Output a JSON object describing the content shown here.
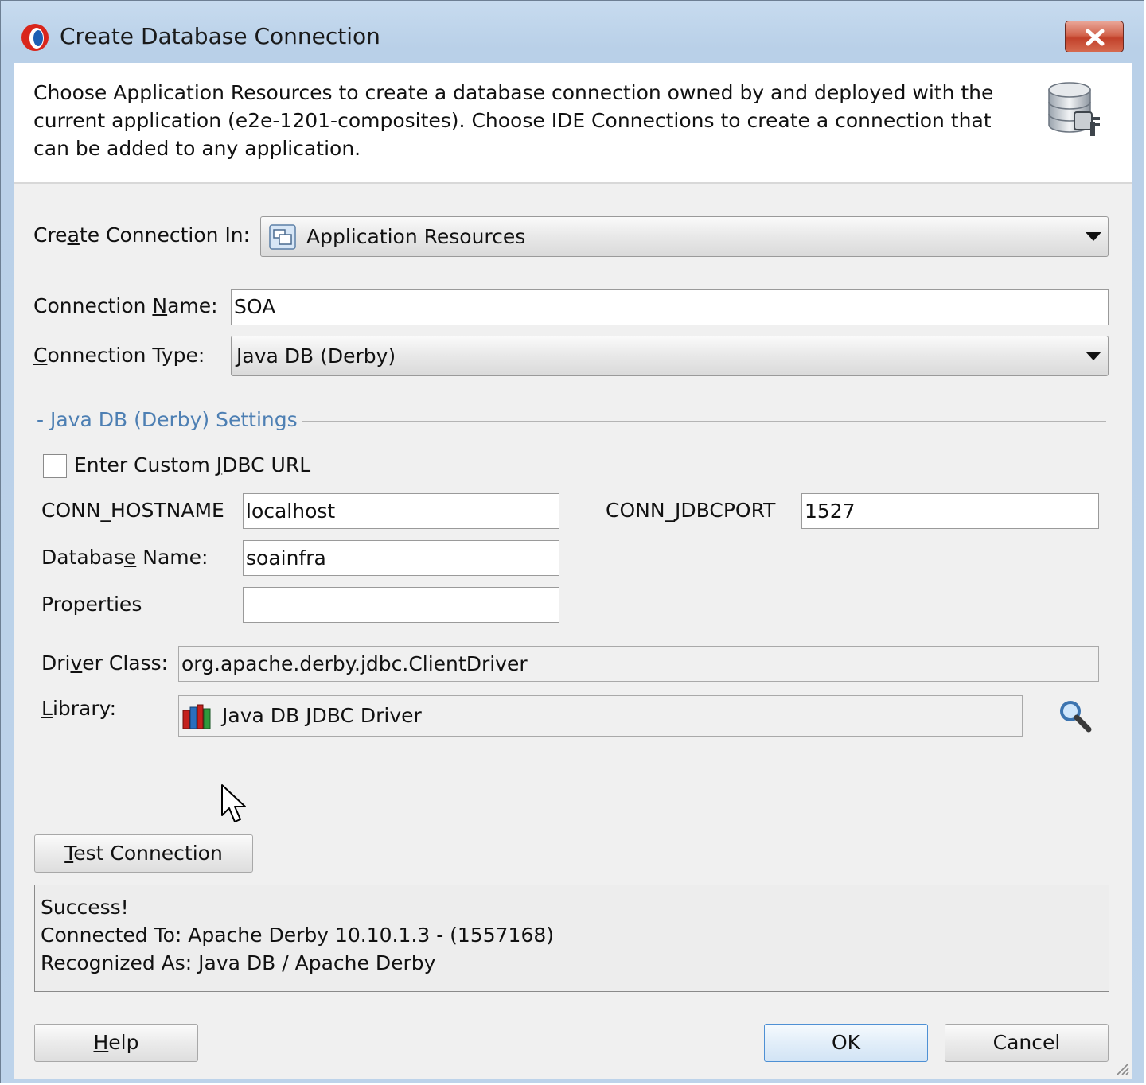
{
  "window": {
    "title": "Create Database Connection",
    "icon": "oracle-icon",
    "close_icon": "close-icon"
  },
  "banner": {
    "text": "Choose Application Resources to create a database connection owned by and deployed with the current application (e2e-1201-composites). Choose IDE Connections to create a connection that can be added to any application.",
    "icon": "database-connection-icon"
  },
  "form": {
    "create_in": {
      "label_pre": "Cre",
      "label_mnemonic": "a",
      "label_post": "te Connection In:",
      "value": "Application Resources",
      "icon": "application-resources-icon"
    },
    "conn_name": {
      "label_pre": "Connection ",
      "label_mnemonic": "N",
      "label_post": "ame:",
      "value": "SOA"
    },
    "conn_type": {
      "label_pre": "",
      "label_mnemonic": "C",
      "label_post": "onnection Type:",
      "value": "Java DB (Derby)"
    }
  },
  "settings": {
    "title": "- Java DB (Derby) Settings",
    "custom_url": {
      "label_pre": "Enter Custom ",
      "label_mnemonic": "J",
      "label_post": "DBC URL",
      "checked": false
    },
    "hostname": {
      "label": "CONN_HOSTNAME",
      "value": "localhost"
    },
    "port": {
      "label": "CONN_JDBCPORT",
      "value": "1527"
    },
    "dbname": {
      "label_pre": "Databas",
      "label_mnemonic": "e",
      "label_post": " Name:",
      "value": "soainfra"
    },
    "properties": {
      "label": "Properties",
      "value": ""
    },
    "driver": {
      "label_pre": "Dri",
      "label_mnemonic": "v",
      "label_post": "er Class:",
      "value": "org.apache.derby.jdbc.ClientDriver"
    },
    "library": {
      "label_pre": "",
      "label_mnemonic": "L",
      "label_post": "ibrary:",
      "value": "Java DB JDBC Driver",
      "icon": "library-books-icon",
      "browse_icon": "magnifier-icon"
    }
  },
  "test": {
    "button_pre": "",
    "button_mnemonic": "T",
    "button_post": "est Connection",
    "result_lines": [
      "Success!",
      "Connected To: Apache Derby 10.10.1.3 - (1557168)",
      "Recognized As: Java DB / Apache Derby"
    ]
  },
  "footer": {
    "help_pre": "",
    "help_mnemonic": "H",
    "help_post": "elp",
    "ok": "OK",
    "cancel": "Cancel"
  },
  "colors": {
    "section_title": "#4d7fb3",
    "default_button_border": "#4e90d4",
    "close_button": "#c2412b"
  }
}
